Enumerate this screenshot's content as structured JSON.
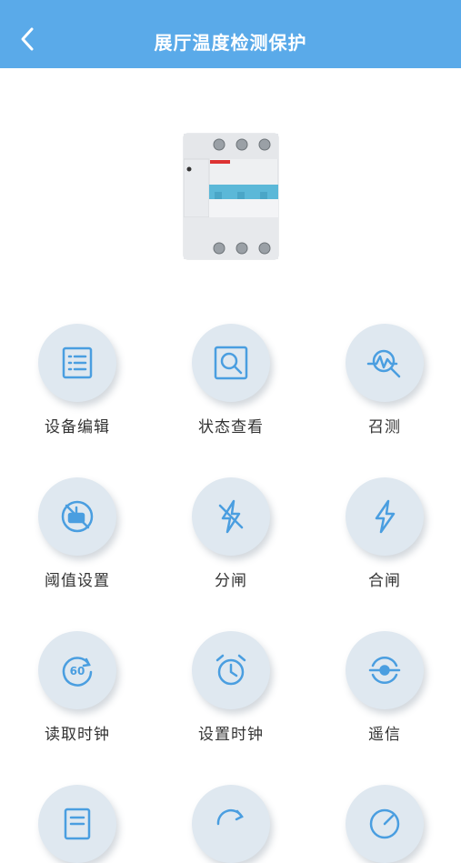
{
  "header": {
    "title": "展厅温度检测保护",
    "back_icon": "chevron-left-icon"
  },
  "device": {
    "image": "circuit-breaker-image"
  },
  "menu": [
    {
      "label": "设备编辑",
      "icon": "list-edit-icon"
    },
    {
      "label": "状态查看",
      "icon": "magnify-status-icon"
    },
    {
      "label": "召测",
      "icon": "pulse-search-icon"
    },
    {
      "label": "阈值设置",
      "icon": "threshold-valve-icon"
    },
    {
      "label": "分闸",
      "icon": "lightning-open-icon"
    },
    {
      "label": "合闸",
      "icon": "lightning-close-icon"
    },
    {
      "label": "读取时钟",
      "icon": "clock-60-icon"
    },
    {
      "label": "设置时钟",
      "icon": "alarm-clock-icon"
    },
    {
      "label": "遥信",
      "icon": "remote-signal-icon"
    },
    {
      "label": "",
      "icon": "document-icon"
    },
    {
      "label": "",
      "icon": "refresh-icon"
    },
    {
      "label": "",
      "icon": "gauge-icon"
    }
  ],
  "colors": {
    "header": "#5aaae9",
    "icon": "#4a9ee0",
    "circle": "#dfe8f0"
  }
}
